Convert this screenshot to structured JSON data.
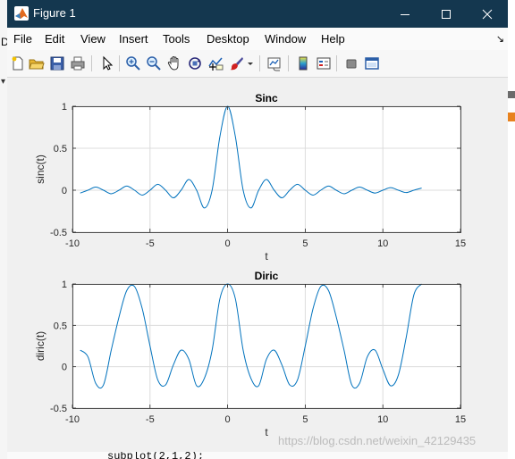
{
  "window": {
    "title": "Figure 1",
    "titlebar_color": "#14374f"
  },
  "menu": {
    "items": [
      "File",
      "Edit",
      "View",
      "Insert",
      "Tools",
      "Desktop",
      "Window",
      "Help"
    ]
  },
  "toolbar": {
    "icons": [
      "new-figure-icon",
      "open-file-icon",
      "save-icon",
      "print-icon",
      "pointer-icon",
      "zoom-in-icon",
      "zoom-out-icon",
      "pan-icon",
      "rotate-3d-icon",
      "data-cursor-icon",
      "brush-icon",
      "link-plot-icon",
      "colorbar-icon",
      "legend-icon",
      "hide-plot-tools-icon",
      "show-plot-tools-icon"
    ]
  },
  "background_code": "subplot(2,1,2);",
  "watermark": "https://blog.csdn.net/weixin_42129435",
  "line_color": "#0072bd",
  "chart_data": [
    {
      "type": "line",
      "title": "Sinc",
      "xlabel": "t",
      "ylabel": "sinc(t)",
      "xlim": [
        -10,
        15
      ],
      "ylim": [
        -0.5,
        1
      ],
      "xticks": [
        -10,
        -5,
        0,
        5,
        10,
        15
      ],
      "yticks": [
        -0.5,
        0,
        0.5,
        1
      ],
      "xtick_labels": [
        "-10",
        "-5",
        "0",
        "5",
        "10",
        "15"
      ],
      "ytick_labels": [
        "-0.5",
        "0",
        "0.5",
        "1"
      ],
      "grid": true,
      "series": [
        {
          "function": "sin(pi*t)/(pi*t)",
          "x": [
            -9.5,
            -9,
            -8.5,
            -8,
            -7.5,
            -7,
            -6.5,
            -6,
            -5.5,
            -5,
            -4.5,
            -4,
            -3.5,
            -3,
            -2.5,
            -2,
            -1.5,
            -1,
            -0.5,
            0,
            0.5,
            1,
            1.5,
            2,
            2.5,
            3,
            3.5,
            4,
            4.5,
            5,
            5.5,
            6,
            6.5,
            7,
            7.5,
            8,
            8.5,
            9,
            9.5,
            10,
            10.5,
            11,
            11.5,
            12,
            12.5
          ],
          "y": [
            -0.034,
            0,
            0.037,
            0,
            -0.042,
            0,
            0.049,
            0,
            -0.058,
            0,
            0.071,
            0,
            -0.091,
            0,
            0.127,
            0,
            -0.212,
            0,
            0.637,
            1,
            0.637,
            0,
            -0.212,
            0,
            0.127,
            0,
            -0.091,
            0,
            0.071,
            0,
            -0.058,
            0,
            0.049,
            0,
            -0.042,
            0,
            0.037,
            0,
            -0.034,
            0,
            0.03,
            0,
            -0.028,
            0,
            0.025
          ]
        }
      ]
    },
    {
      "type": "line",
      "title": "Diric",
      "xlabel": "t",
      "ylabel": "diric(t)",
      "xlim": [
        -10,
        15
      ],
      "ylim": [
        -0.5,
        1
      ],
      "xticks": [
        -10,
        -5,
        0,
        5,
        10,
        15
      ],
      "yticks": [
        -0.5,
        0,
        0.5,
        1
      ],
      "xtick_labels": [
        "-10",
        "-5",
        "0",
        "5",
        "10",
        "15"
      ],
      "ytick_labels": [
        "-0.5",
        "0",
        "0.5",
        "1"
      ],
      "grid": true,
      "series": [
        {
          "function": "diric(t,5)",
          "x": [
            -9.5,
            -9,
            -8.5,
            -8,
            -7.5,
            -7,
            -6.5,
            -6,
            -5.5,
            -5,
            -4.5,
            -4,
            -3.5,
            -3,
            -2.5,
            -2,
            -1.5,
            -1,
            -0.5,
            0,
            0.5,
            1,
            1.5,
            2,
            2.5,
            3,
            3.5,
            4,
            4.5,
            5,
            5.5,
            6,
            6.5,
            7,
            7.5,
            8,
            8.5,
            9,
            9.5,
            10,
            10.5,
            11,
            11.5,
            12,
            12.5
          ],
          "y": [
            0.2,
            0.12,
            -0.2,
            -0.22,
            0.2,
            0.6,
            0.92,
            0.97,
            0.7,
            0.25,
            -0.16,
            -0.22,
            0.02,
            0.2,
            0.09,
            -0.23,
            -0.14,
            0.2,
            0.82,
            1,
            0.82,
            0.2,
            -0.14,
            -0.23,
            0.09,
            0.2,
            0.02,
            -0.22,
            -0.16,
            0.25,
            0.7,
            0.97,
            0.92,
            0.6,
            0.2,
            -0.22,
            -0.2,
            0.12,
            0.2,
            -0.03,
            -0.23,
            -0.1,
            0.35,
            0.87,
            1
          ]
        }
      ]
    }
  ]
}
